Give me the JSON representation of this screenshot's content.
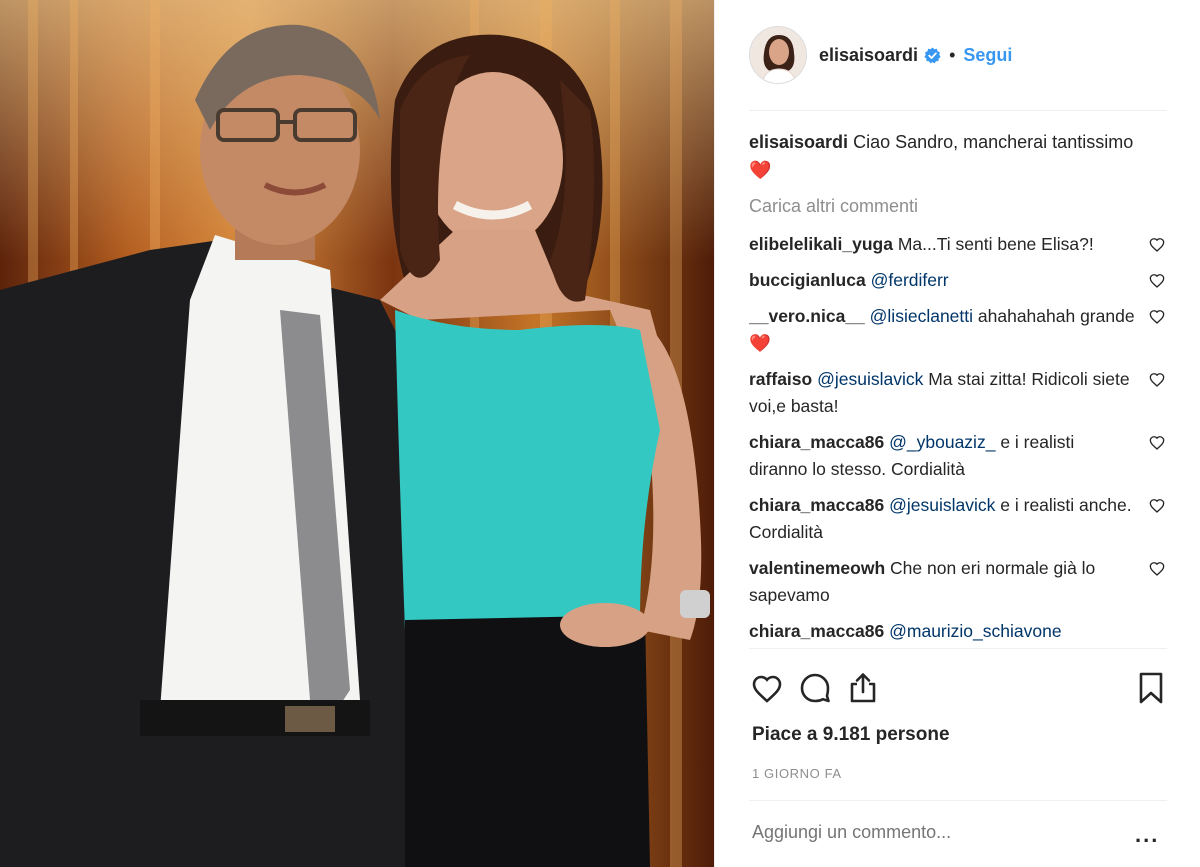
{
  "post": {
    "image_alt": "Sandro Mayer and Elisa Isoardi",
    "account": {
      "username": "elisaisoardi",
      "verified": true,
      "separator": "•",
      "follow_label": "Segui"
    },
    "caption": {
      "username": "elisaisoardi",
      "text": "Ciao Sandro, mancherai tantissimo",
      "emoji": "❤️"
    },
    "load_more_label": "Carica altri commenti",
    "comments": [
      {
        "username": "elibelelikali_yuga",
        "mention": "",
        "text": "Ma...Ti senti bene Elisa?!"
      },
      {
        "username": "buccigianluca",
        "mention": "@ferdiferr",
        "text": ""
      },
      {
        "username": "__vero.nica__",
        "mention": "@lisieclanetti",
        "text": "ahahahahah grande",
        "emoji": "❤️"
      },
      {
        "username": "raffaiso",
        "mention": "@jesuislavick",
        "text": "Ma stai zitta! Ridicoli siete voi,e basta!"
      },
      {
        "username": "chiara_macca86",
        "mention": "@_ybouaziz_",
        "text": "e i realisti diranno lo stesso. Cordialità"
      },
      {
        "username": "chiara_macca86",
        "mention": "@jesuislavick",
        "text": "e i realisti anche. Cordialità"
      },
      {
        "username": "valentinemeowh",
        "mention": "",
        "text": "Che non eri normale già lo sapevamo"
      },
      {
        "username": "chiara_macca86",
        "mention": "@maurizio_schiavone",
        "text": ""
      }
    ],
    "actions": {
      "like_icon": "heart-outline-icon",
      "comment_icon": "comment-bubble-icon",
      "share_icon": "share-upload-icon",
      "save_icon": "bookmark-icon"
    },
    "likes_text": "Piace a 9.181 persone",
    "timestamp": "1 GIORNO FA",
    "add_comment_placeholder": "Aggiungi un commento...",
    "more_options_label": "..."
  },
  "colors": {
    "link_blue": "#3897f0",
    "mention_blue": "#003569",
    "muted_gray": "#8e8e8e",
    "text_dark": "#262626",
    "verified_blue": "#3897f0",
    "heart_red": "#e0162b"
  }
}
